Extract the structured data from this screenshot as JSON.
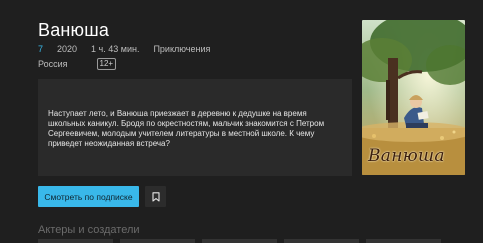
{
  "movie": {
    "title": "Ванюша",
    "rating": "7",
    "year": "2020",
    "duration": "1 ч. 43 мин.",
    "genre": "Приключения",
    "country": "Россия",
    "age_rating": "12+",
    "description": "Наступает лето, и Ванюша приезжает в деревню к дедушке на время школьных каникул. Бродя по окрестностям, мальчик знакомится с Петром Сергеевичем, молодым учителем литературы в местной школе. К чему приведет неожиданная встреча?"
  },
  "poster": {
    "title": "Ванюша"
  },
  "actions": {
    "watch_label": "Смотреть по подписке",
    "bookmark_icon": "bookmark-icon"
  },
  "cast_section": {
    "title": "Актеры и создатели"
  },
  "colors": {
    "background": "#1f1f1f",
    "accent": "#39b8ea"
  }
}
